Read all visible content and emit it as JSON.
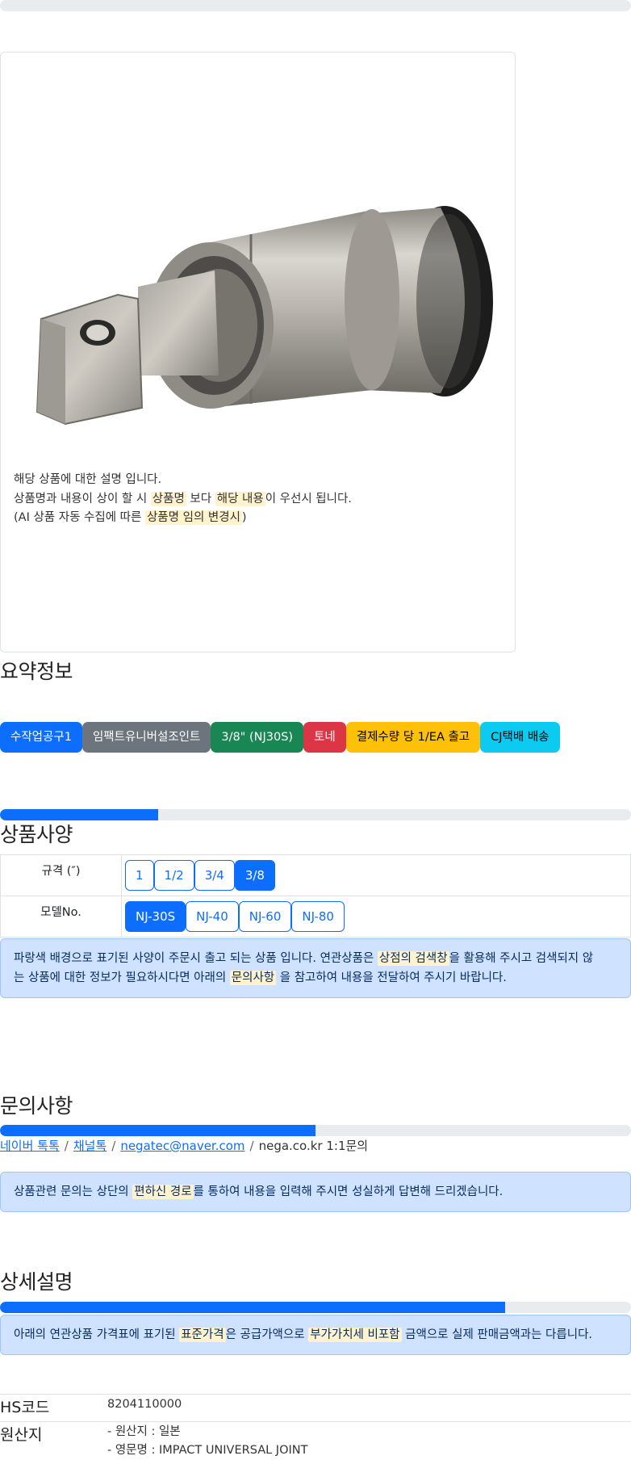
{
  "top_progress": {
    "value": 0
  },
  "product": {
    "image_icon": "universal-joint-photo",
    "description_lines": [
      {
        "parts": [
          {
            "text": "해당 상품에 대한 설명 입니다.",
            "hl": false
          }
        ]
      },
      {
        "parts": [
          {
            "text": "상품명과 내용이 상이 할 시 ",
            "hl": false
          },
          {
            "text": "상품명",
            "hl": true
          },
          {
            "text": " 보다 ",
            "hl": false
          },
          {
            "text": "해당 내용",
            "hl": true
          },
          {
            "text": "이 우선시 됩니다.",
            "hl": false
          }
        ]
      },
      {
        "parts": [
          {
            "text": "(AI 상품 자동 수집에 따른 ",
            "hl": false
          },
          {
            "text": "상품명 임의 변경시",
            "hl": true
          },
          {
            "text": ")",
            "hl": false
          }
        ]
      }
    ]
  },
  "summary": {
    "title": "요약정보",
    "badges": [
      {
        "label": "수작업공구1",
        "bg": "#0d6efd",
        "fg": "#ffffff"
      },
      {
        "label": "임팩트유니버설조인트",
        "bg": "#6c757d",
        "fg": "#ffffff"
      },
      {
        "label": "3/8\" (NJ30S)",
        "bg": "#198754",
        "fg": "#ffffff"
      },
      {
        "label": "토네",
        "bg": "#dc3545",
        "fg": "#ffffff"
      },
      {
        "label": "결제수량 당 1/EA 출고",
        "bg": "#ffc107",
        "fg": "#000000"
      },
      {
        "label": "CJ택배 배송",
        "bg": "#0dcaf0",
        "fg": "#000000"
      }
    ]
  },
  "specs": {
    "progress": 0.25,
    "title": "상품사양",
    "rows": [
      {
        "label": "규격 (″)",
        "options": [
          "1",
          "1/2",
          "3/4",
          "3/8"
        ],
        "active": "3/8"
      },
      {
        "label": "모델No.",
        "options": [
          "NJ-30S",
          "NJ-40",
          "NJ-60",
          "NJ-80"
        ],
        "active": "NJ-30S"
      }
    ],
    "notice_lines": [
      {
        "parts": [
          {
            "text": "파랑색 배경으로 표기된 사양이 주문시 출고 되는 상품 입니다. 연관상품은 ",
            "hl": false
          },
          {
            "text": "상점의 검색창",
            "hl": true
          },
          {
            "text": "을 활용해 주시고 검색되지 않",
            "hl": false
          }
        ]
      },
      {
        "parts": [
          {
            "text": "는 상품에 대한 정보가 필요하시다면 아래의 ",
            "hl": false
          },
          {
            "text": "문의사항",
            "hl": true
          },
          {
            "text": " 을 참고하여 내용을 전달하여 주시기 바랍니다.",
            "hl": false
          }
        ]
      }
    ]
  },
  "inquiry": {
    "title": "문의사항",
    "progress": 0.5,
    "links": [
      {
        "text": "네이버 톡톡",
        "link": true
      },
      {
        "text": "채널톡",
        "link": true
      },
      {
        "text": "negatec@naver.com",
        "link": true
      },
      {
        "text": "nega.co.kr 1:1문의",
        "link": false
      }
    ],
    "notice_lines": [
      {
        "parts": [
          {
            "text": "상품관련 문의는 상단의 ",
            "hl": false
          },
          {
            "text": "편하신 경로",
            "hl": true
          },
          {
            "text": "를 통하여 내용을 입력해 주시면 성실하게 답변해 드리겠습니다.",
            "hl": false
          }
        ]
      }
    ]
  },
  "detail": {
    "title": "상세설명",
    "progress": 0.8,
    "notice_lines": [
      {
        "parts": [
          {
            "text": "아래의 연관상품 가격표에 표기된 ",
            "hl": false
          },
          {
            "text": "표준가격",
            "hl": true
          },
          {
            "text": "은 공급가액으로 ",
            "hl": false
          },
          {
            "text": "부가가치세 비포함",
            "hl": true
          },
          {
            "text": " 금액으로 실제 판매금액과는 다릅니다.",
            "hl": false
          }
        ]
      }
    ],
    "info": [
      {
        "key": "HS코드",
        "values": [
          "8204110000"
        ]
      },
      {
        "key": "원산지",
        "values": [
          "- 원산지 : 일본",
          "- 영문명 : IMPACT UNIVERSAL JOINT"
        ]
      }
    ]
  }
}
